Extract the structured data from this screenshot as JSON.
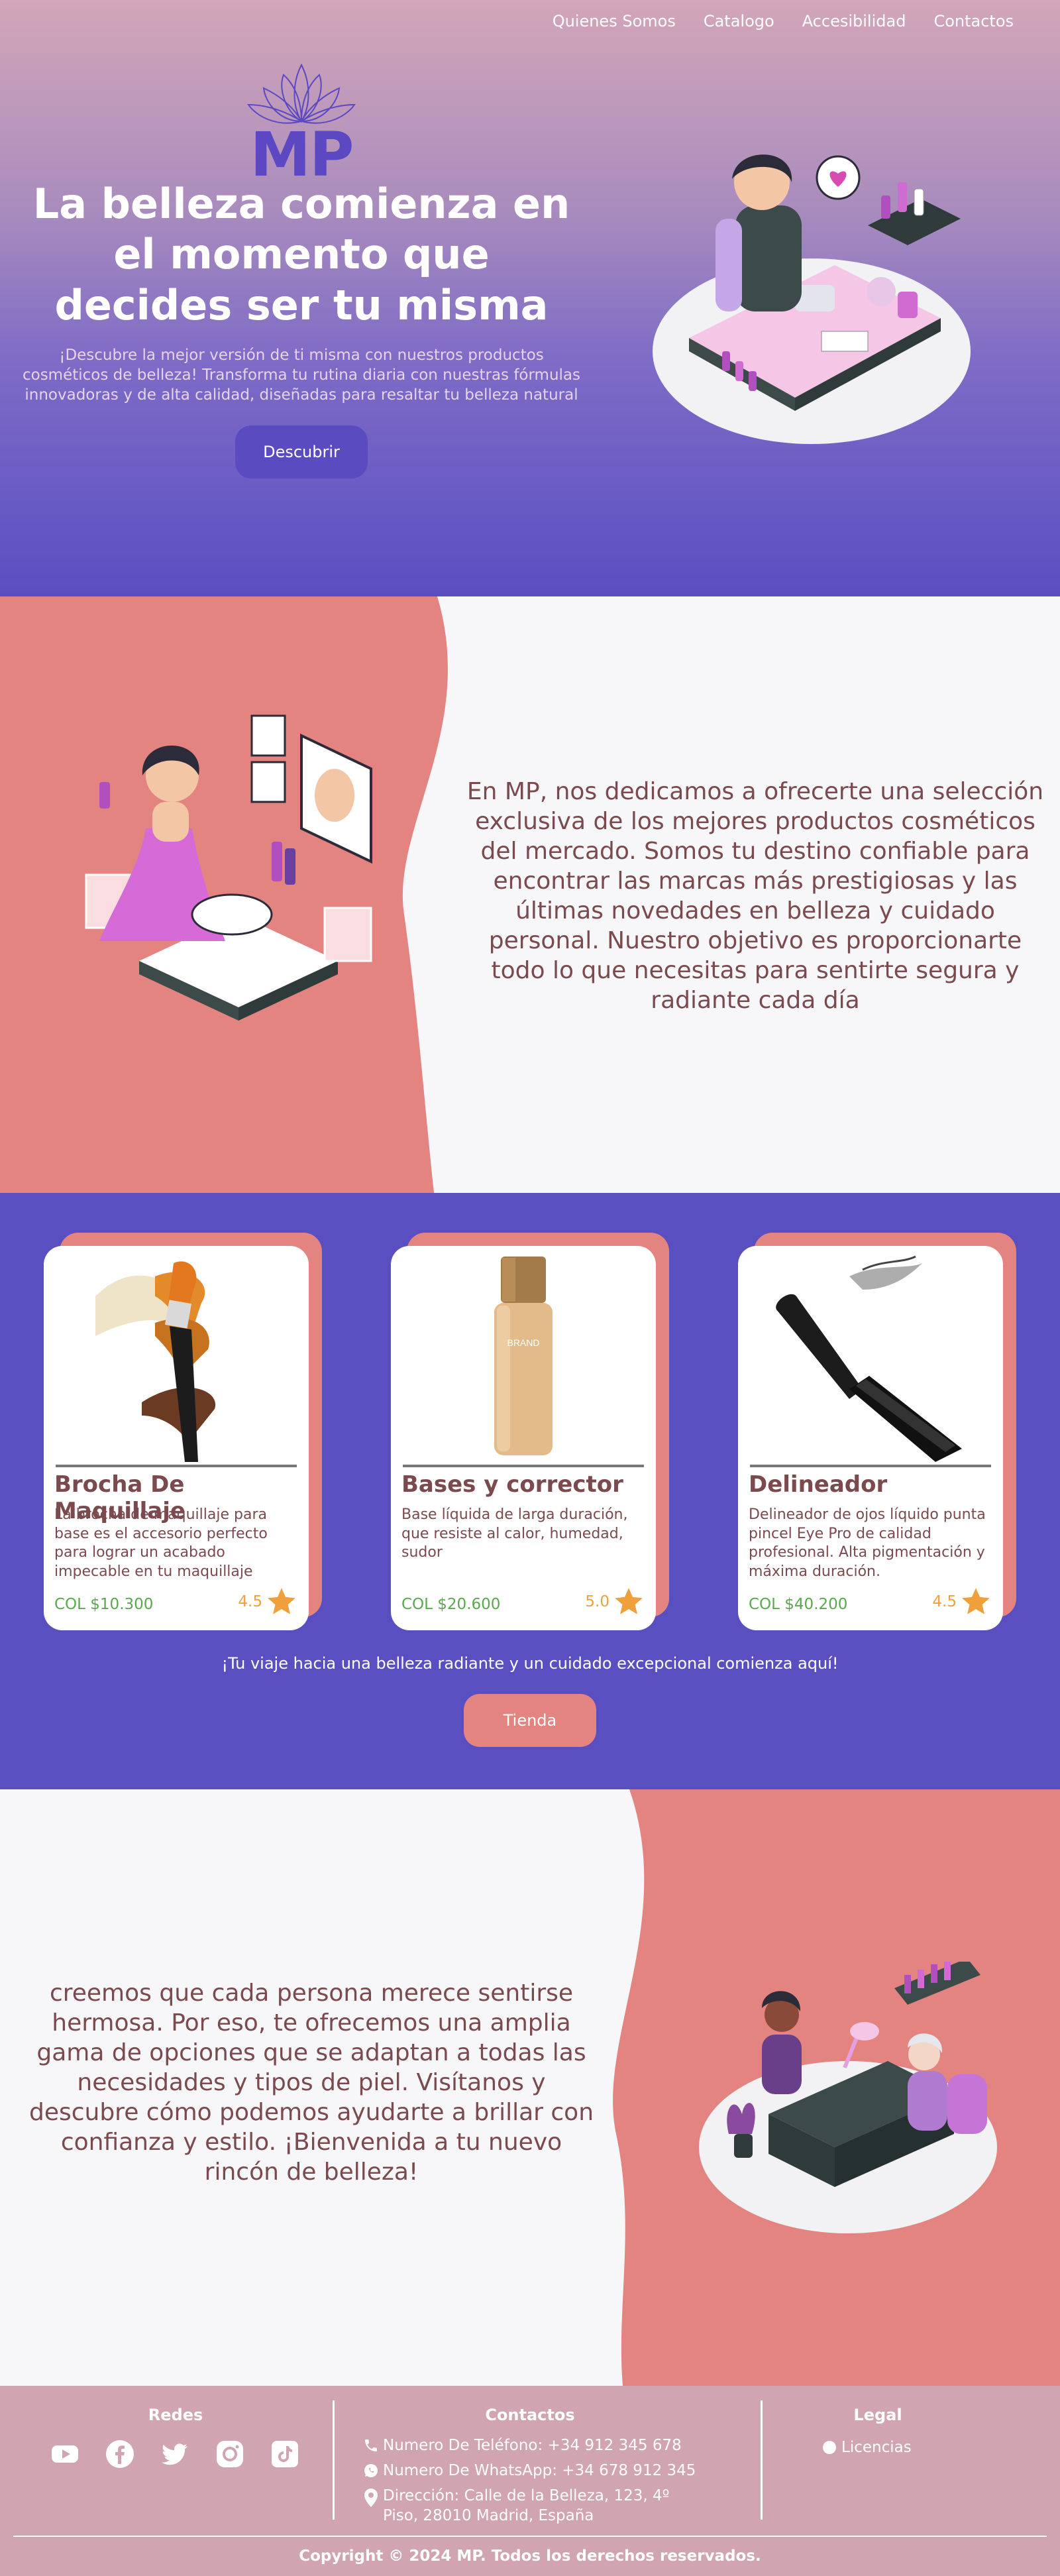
{
  "nav": {
    "items": [
      "Quienes Somos",
      "Catalogo",
      "Accesibilidad",
      "Contactos"
    ]
  },
  "hero": {
    "logo_text": "MP",
    "title": "La belleza comienza en el momento que decides ser tu misma",
    "subtitle": "¡Descubre la mejor versión de ti misma con nuestros productos cosméticos de belleza! Transforma tu rutina diaria con nuestras fórmulas innovadoras y de alta calidad, diseñadas para resaltar tu belleza natural",
    "button_label": "Descubrir"
  },
  "about": {
    "text": "En MP, nos dedicamos a ofrecerte una selección exclusiva de los mejores productos cosméticos del mercado. Somos tu destino confiable para encontrar las marcas más prestigiosas y las últimas novedades en belleza y cuidado personal. Nuestro objetivo es proporcionarte todo lo que necesitas para sentirte segura y radiante cada día"
  },
  "products": {
    "items": [
      {
        "title": "Brocha De Maquillaje",
        "description": "La brocha de maquillaje para base es el accesorio perfecto para lograr un acabado impecable en tu maquillaje",
        "price": "COL $10.300",
        "rating": "4.5"
      },
      {
        "title": "Bases y corrector",
        "description": "Base líquida de larga duración, que resiste al calor, humedad, sudor",
        "price": "COL $20.600",
        "rating": "5.0",
        "image_label": "BRAND"
      },
      {
        "title": "Delineador",
        "description": "Delineador de ojos líquido punta pincel Eye Pro de calidad profesional. Alta pigmentación y máxima duración.",
        "price": "COL $40.200",
        "rating": "4.5"
      }
    ],
    "tagline": "¡Tu viaje hacia una belleza radiante y un cuidado excepcional comienza aquí!",
    "button_label": "Tienda"
  },
  "welcome": {
    "text": "creemos que cada persona merece sentirse hermosa. Por eso, te ofrecemos una amplia gama de opciones que se adaptan a todas las necesidades y tipos de piel. Visítanos y descubre cómo podemos ayudarte a brillar con confianza y estilo. ¡Bienvenida a tu nuevo rincón de belleza!"
  },
  "footer": {
    "redes_title": "Redes",
    "social_icons": [
      "youtube-icon",
      "facebook-icon",
      "twitter-icon",
      "instagram-icon",
      "tiktok-icon"
    ],
    "contactos_title": "Contactos",
    "phone": "Numero De Teléfono: +34 912 345 678",
    "whatsapp": "Numero De WhatsApp: +34 678 912 345",
    "address": "Dirección: Calle de la Belleza, 123, 4º Piso, 28010 Madrid, España",
    "legal_title": "Legal",
    "legal_item": "Licencias",
    "copyright": "Copyright ©  2024 MP. Todos los derechos reservados."
  },
  "colors": {
    "primary": "#5a4fc0",
    "coral": "#e48480",
    "text_brown": "#7a4a4e",
    "price_green": "#5aa84e",
    "star_orange": "#f0a03a",
    "footer_pink": "#d1a4b2"
  }
}
